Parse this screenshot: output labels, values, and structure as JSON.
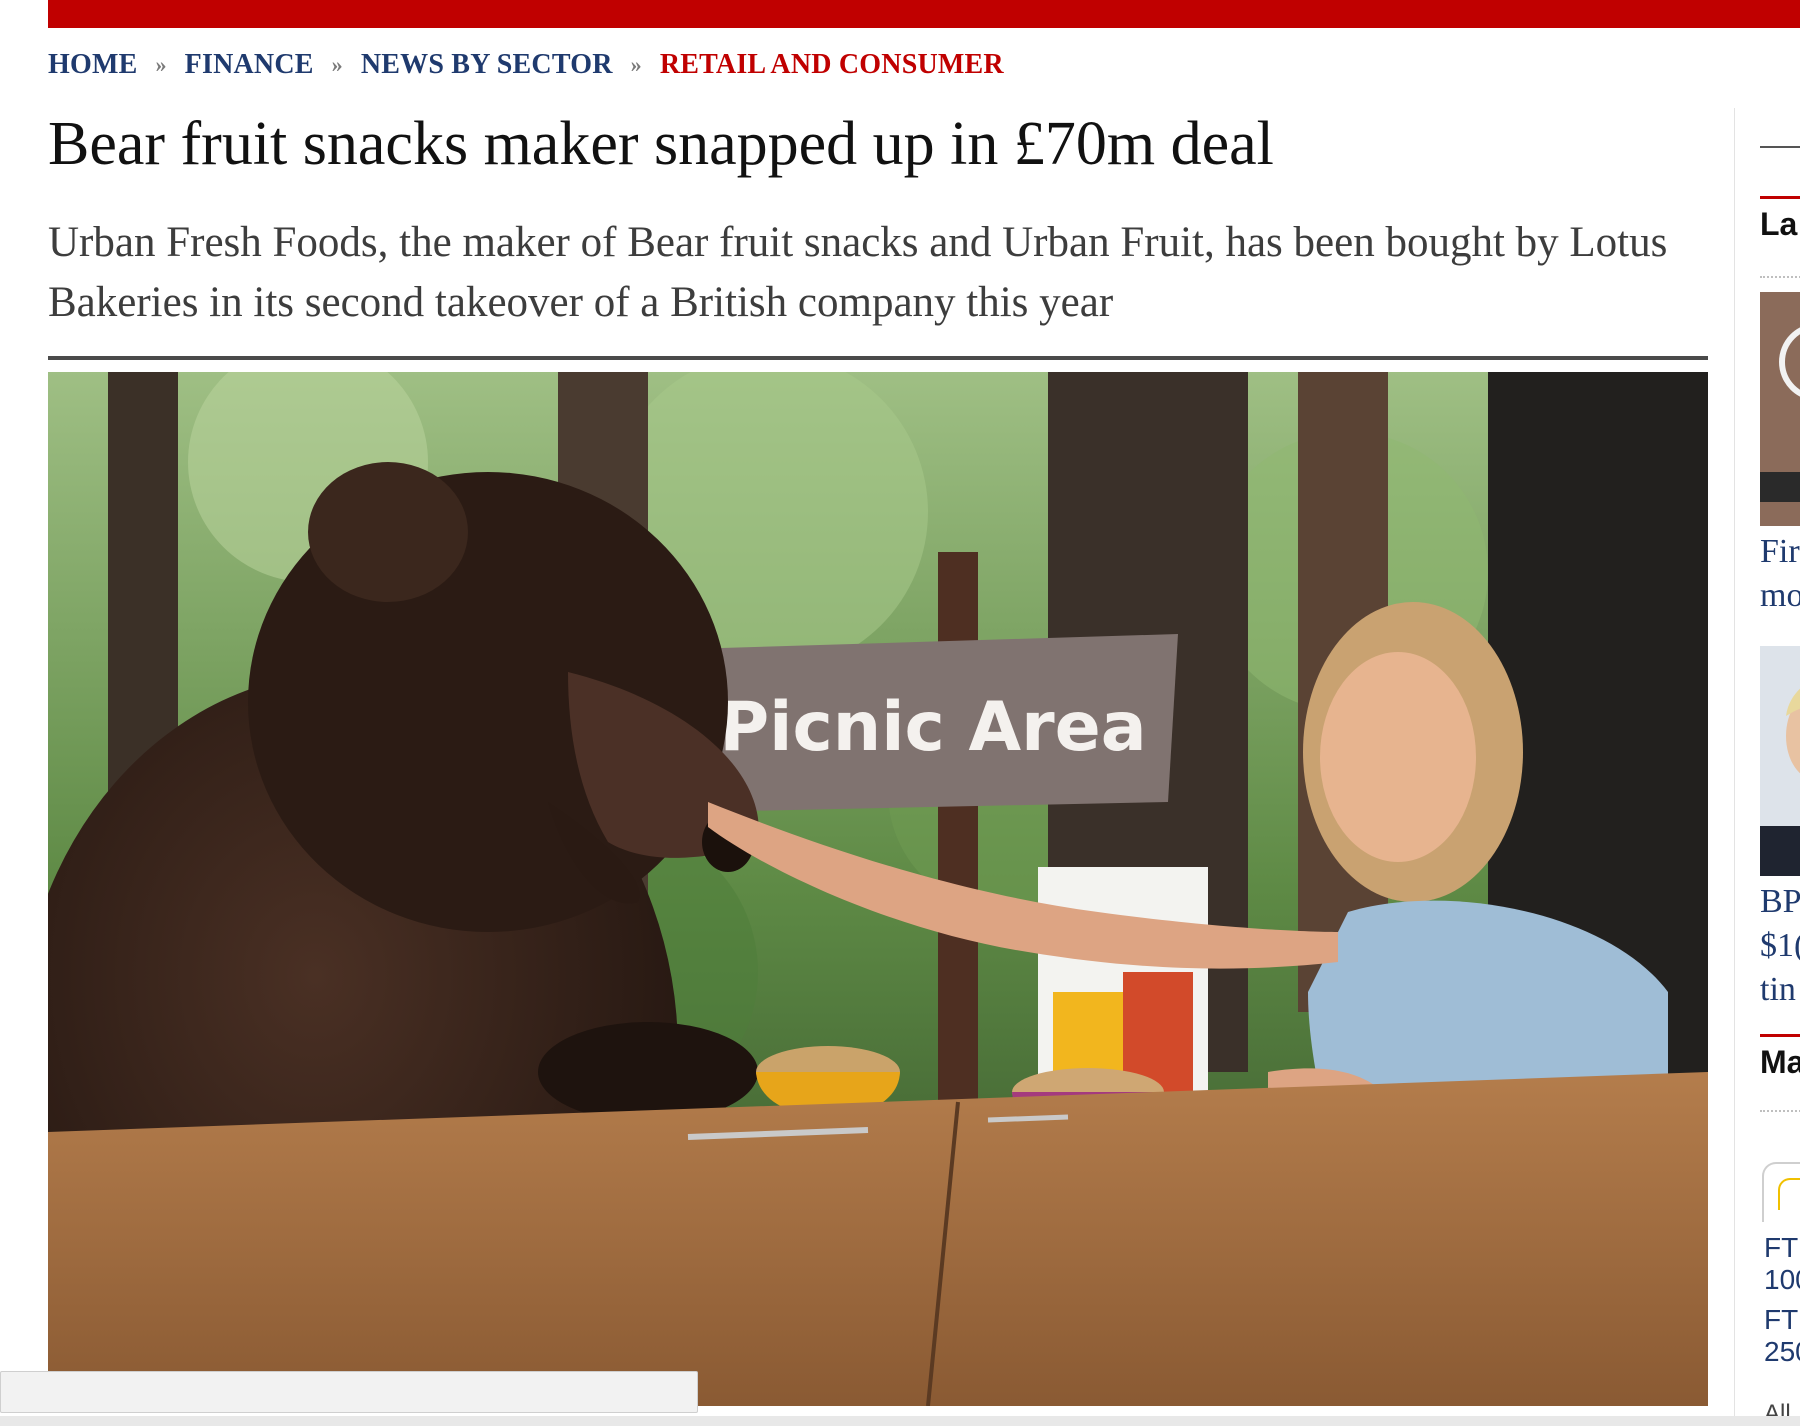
{
  "breadcrumb": [
    {
      "label": "HOME",
      "current": false
    },
    {
      "label": "FINANCE",
      "current": false
    },
    {
      "label": "NEWS BY SECTOR",
      "current": false
    },
    {
      "label": "RETAIL AND CONSUMER",
      "current": true
    }
  ],
  "breadcrumb_separator": "»",
  "article": {
    "headline": "Bear fruit snacks maker snapped up in £70m deal",
    "standfirst": "Urban Fresh Foods, the maker of Bear fruit snacks and Urban Fruit, has been bought by Lotus Bakeries in its second takeover of a British company this year",
    "image_sign_text": "Picnic Area"
  },
  "sidebar": {
    "latest_heading": "La",
    "story_1": [
      "Fir",
      "mo"
    ],
    "story_2": [
      "BP",
      "$1(",
      "tin"
    ],
    "markets_heading": "Ma",
    "markets": [
      [
        "FT",
        "100"
      ],
      [
        "FT",
        "250"
      ]
    ],
    "footer_fragment": "All"
  },
  "colors": {
    "brand_red": "#c00000",
    "link_navy": "#1f3a6e"
  }
}
